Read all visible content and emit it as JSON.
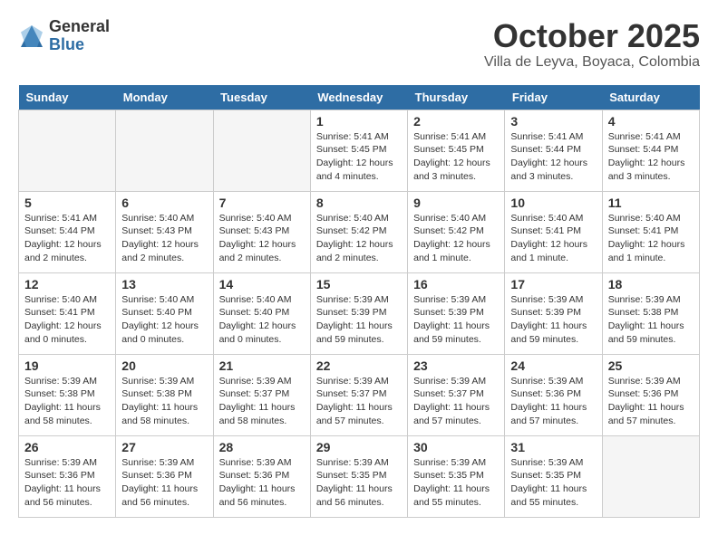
{
  "header": {
    "logo_general": "General",
    "logo_blue": "Blue",
    "month_title": "October 2025",
    "location": "Villa de Leyva, Boyaca, Colombia"
  },
  "weekdays": [
    "Sunday",
    "Monday",
    "Tuesday",
    "Wednesday",
    "Thursday",
    "Friday",
    "Saturday"
  ],
  "weeks": [
    [
      {
        "day": "",
        "info": ""
      },
      {
        "day": "",
        "info": ""
      },
      {
        "day": "",
        "info": ""
      },
      {
        "day": "1",
        "info": "Sunrise: 5:41 AM\nSunset: 5:45 PM\nDaylight: 12 hours\nand 4 minutes."
      },
      {
        "day": "2",
        "info": "Sunrise: 5:41 AM\nSunset: 5:45 PM\nDaylight: 12 hours\nand 3 minutes."
      },
      {
        "day": "3",
        "info": "Sunrise: 5:41 AM\nSunset: 5:44 PM\nDaylight: 12 hours\nand 3 minutes."
      },
      {
        "day": "4",
        "info": "Sunrise: 5:41 AM\nSunset: 5:44 PM\nDaylight: 12 hours\nand 3 minutes."
      }
    ],
    [
      {
        "day": "5",
        "info": "Sunrise: 5:41 AM\nSunset: 5:44 PM\nDaylight: 12 hours\nand 2 minutes."
      },
      {
        "day": "6",
        "info": "Sunrise: 5:40 AM\nSunset: 5:43 PM\nDaylight: 12 hours\nand 2 minutes."
      },
      {
        "day": "7",
        "info": "Sunrise: 5:40 AM\nSunset: 5:43 PM\nDaylight: 12 hours\nand 2 minutes."
      },
      {
        "day": "8",
        "info": "Sunrise: 5:40 AM\nSunset: 5:42 PM\nDaylight: 12 hours\nand 2 minutes."
      },
      {
        "day": "9",
        "info": "Sunrise: 5:40 AM\nSunset: 5:42 PM\nDaylight: 12 hours\nand 1 minute."
      },
      {
        "day": "10",
        "info": "Sunrise: 5:40 AM\nSunset: 5:41 PM\nDaylight: 12 hours\nand 1 minute."
      },
      {
        "day": "11",
        "info": "Sunrise: 5:40 AM\nSunset: 5:41 PM\nDaylight: 12 hours\nand 1 minute."
      }
    ],
    [
      {
        "day": "12",
        "info": "Sunrise: 5:40 AM\nSunset: 5:41 PM\nDaylight: 12 hours\nand 0 minutes."
      },
      {
        "day": "13",
        "info": "Sunrise: 5:40 AM\nSunset: 5:40 PM\nDaylight: 12 hours\nand 0 minutes."
      },
      {
        "day": "14",
        "info": "Sunrise: 5:40 AM\nSunset: 5:40 PM\nDaylight: 12 hours\nand 0 minutes."
      },
      {
        "day": "15",
        "info": "Sunrise: 5:39 AM\nSunset: 5:39 PM\nDaylight: 11 hours\nand 59 minutes."
      },
      {
        "day": "16",
        "info": "Sunrise: 5:39 AM\nSunset: 5:39 PM\nDaylight: 11 hours\nand 59 minutes."
      },
      {
        "day": "17",
        "info": "Sunrise: 5:39 AM\nSunset: 5:39 PM\nDaylight: 11 hours\nand 59 minutes."
      },
      {
        "day": "18",
        "info": "Sunrise: 5:39 AM\nSunset: 5:38 PM\nDaylight: 11 hours\nand 59 minutes."
      }
    ],
    [
      {
        "day": "19",
        "info": "Sunrise: 5:39 AM\nSunset: 5:38 PM\nDaylight: 11 hours\nand 58 minutes."
      },
      {
        "day": "20",
        "info": "Sunrise: 5:39 AM\nSunset: 5:38 PM\nDaylight: 11 hours\nand 58 minutes."
      },
      {
        "day": "21",
        "info": "Sunrise: 5:39 AM\nSunset: 5:37 PM\nDaylight: 11 hours\nand 58 minutes."
      },
      {
        "day": "22",
        "info": "Sunrise: 5:39 AM\nSunset: 5:37 PM\nDaylight: 11 hours\nand 57 minutes."
      },
      {
        "day": "23",
        "info": "Sunrise: 5:39 AM\nSunset: 5:37 PM\nDaylight: 11 hours\nand 57 minutes."
      },
      {
        "day": "24",
        "info": "Sunrise: 5:39 AM\nSunset: 5:36 PM\nDaylight: 11 hours\nand 57 minutes."
      },
      {
        "day": "25",
        "info": "Sunrise: 5:39 AM\nSunset: 5:36 PM\nDaylight: 11 hours\nand 57 minutes."
      }
    ],
    [
      {
        "day": "26",
        "info": "Sunrise: 5:39 AM\nSunset: 5:36 PM\nDaylight: 11 hours\nand 56 minutes."
      },
      {
        "day": "27",
        "info": "Sunrise: 5:39 AM\nSunset: 5:36 PM\nDaylight: 11 hours\nand 56 minutes."
      },
      {
        "day": "28",
        "info": "Sunrise: 5:39 AM\nSunset: 5:36 PM\nDaylight: 11 hours\nand 56 minutes."
      },
      {
        "day": "29",
        "info": "Sunrise: 5:39 AM\nSunset: 5:35 PM\nDaylight: 11 hours\nand 56 minutes."
      },
      {
        "day": "30",
        "info": "Sunrise: 5:39 AM\nSunset: 5:35 PM\nDaylight: 11 hours\nand 55 minutes."
      },
      {
        "day": "31",
        "info": "Sunrise: 5:39 AM\nSunset: 5:35 PM\nDaylight: 11 hours\nand 55 minutes."
      },
      {
        "day": "",
        "info": ""
      }
    ]
  ]
}
